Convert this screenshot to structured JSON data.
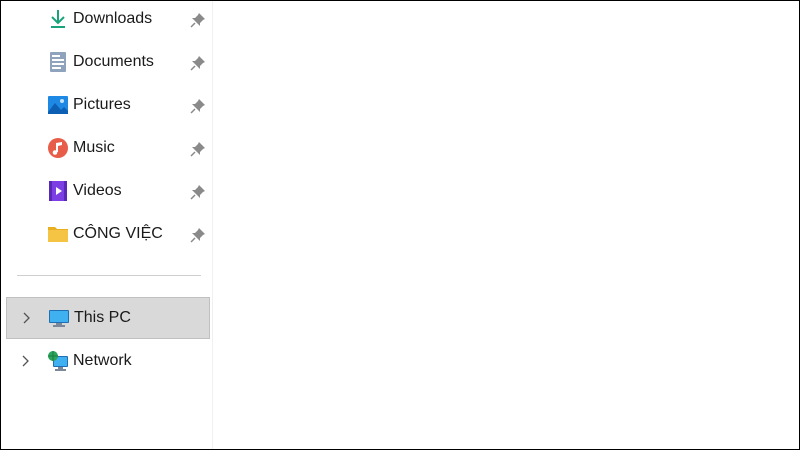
{
  "quick_access": [
    {
      "label": "Downloads",
      "icon": "download-icon",
      "pinned": true
    },
    {
      "label": "Documents",
      "icon": "documents-icon",
      "pinned": true
    },
    {
      "label": "Pictures",
      "icon": "pictures-icon",
      "pinned": true
    },
    {
      "label": "Music",
      "icon": "music-icon",
      "pinned": true
    },
    {
      "label": "Videos",
      "icon": "videos-icon",
      "pinned": true
    },
    {
      "label": "CÔNG VIỆC",
      "icon": "folder-icon",
      "pinned": true
    }
  ],
  "locations": [
    {
      "label": "This PC",
      "icon": "computer-icon",
      "selected": true
    },
    {
      "label": "Network",
      "icon": "network-icon",
      "selected": false
    }
  ],
  "colors": {
    "selection_bg": "#d9d9d9",
    "download_accent": "#1aa37a",
    "folder": "#f6c445",
    "pictures": "#1e88e5",
    "music": "#e85d4a",
    "videos": "#7b3fe4"
  }
}
